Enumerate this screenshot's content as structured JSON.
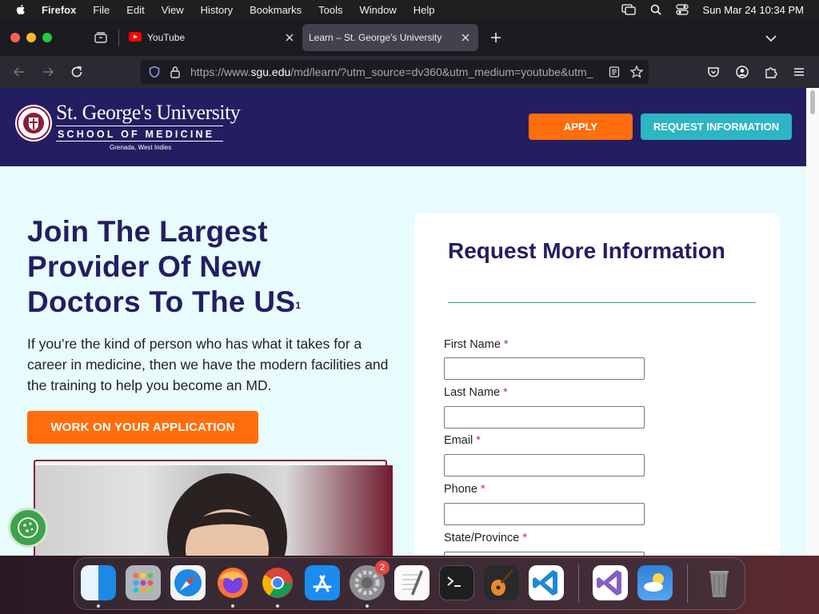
{
  "menubar": {
    "app_name": "Firefox",
    "items": [
      "File",
      "Edit",
      "View",
      "History",
      "Bookmarks",
      "Tools",
      "Window",
      "Help"
    ],
    "clock": "Sun Mar 24  10:34 PM"
  },
  "browser": {
    "tabs": [
      {
        "title": "YouTube",
        "active": false
      },
      {
        "title": "Learn – St. George's University",
        "active": true
      }
    ],
    "url_prefix": "https://www.",
    "url_domain": "sgu.edu",
    "url_rest": "/md/learn/?utm_source=dv360&utm_medium=youtube&utm_"
  },
  "site": {
    "logo": {
      "name": "St. George's University",
      "school": "SCHOOL OF MEDICINE",
      "location": "Grenada, West Indies"
    },
    "header_buttons": {
      "apply": "APPLY",
      "request_info": "REQUEST INFORMATION"
    },
    "hero": {
      "title": "Join The Largest Provider Of New Doctors To The US",
      "footnote": "1",
      "text": "If you’re the kind of person who has what it takes for a career in medicine, then we have the modern facilities and the training to help you become an MD.",
      "cta": "WORK ON YOUR APPLICATION"
    },
    "form": {
      "title": "Request More Information",
      "required_mark": "*",
      "fields": [
        {
          "label": "First Name",
          "value": ""
        },
        {
          "label": "Last Name",
          "value": ""
        },
        {
          "label": "Email",
          "value": ""
        },
        {
          "label": "Phone",
          "value": ""
        },
        {
          "label": "State/Province",
          "value": ""
        }
      ]
    }
  },
  "dock": {
    "apps": [
      "Finder",
      "Launchpad",
      "Safari",
      "Firefox",
      "Chrome",
      "App Store",
      "System Settings",
      "TextEdit",
      "Terminal",
      "GarageBand",
      "Visual Studio Code",
      "Visual Studio",
      "Weather",
      "Trash"
    ],
    "settings_badge": "2"
  },
  "colors": {
    "brand_navy": "#231e61",
    "brand_orange": "#ff6d0c",
    "brand_teal": "#2db5c3"
  }
}
